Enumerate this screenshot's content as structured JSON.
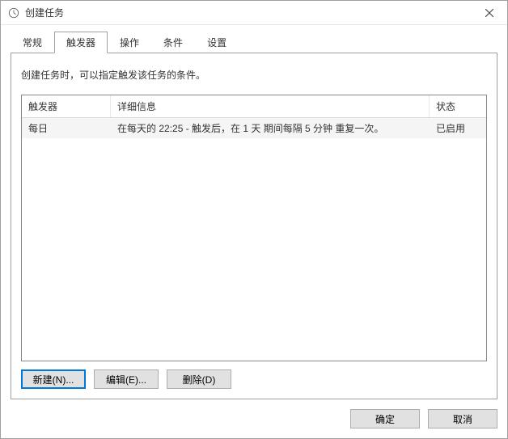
{
  "window": {
    "title": "创建任务"
  },
  "tabs": {
    "general": "常规",
    "triggers": "触发器",
    "actions": "操作",
    "conditions": "条件",
    "settings": "设置"
  },
  "content": {
    "info": "创建任务时，可以指定触发该任务的条件。"
  },
  "columns": {
    "trigger": "触发器",
    "details": "详细信息",
    "status": "状态"
  },
  "rows": [
    {
      "trigger": "每日",
      "details": "在每天的 22:25 - 触发后，在 1 天 期间每隔 5 分钟 重复一次。",
      "status": "已启用"
    }
  ],
  "buttons": {
    "new": "新建(N)...",
    "edit": "编辑(E)...",
    "delete": "删除(D)",
    "ok": "确定",
    "cancel": "取消"
  }
}
